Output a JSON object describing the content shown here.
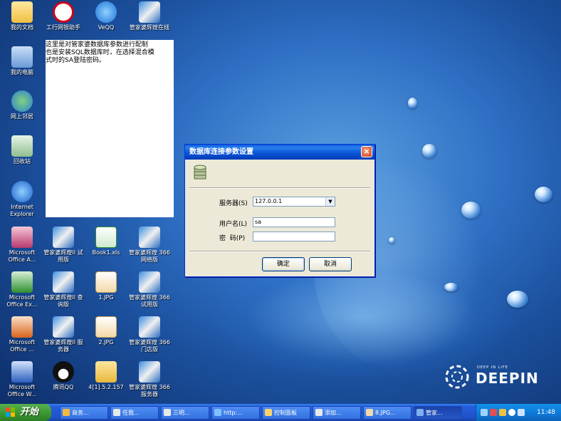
{
  "desktop": {
    "icons": [
      {
        "label": "我的文档",
        "icon": "my-documents-icon"
      },
      {
        "label": "工行网银助手",
        "icon": "icbc-bank-icon"
      },
      {
        "label": "VeQQ",
        "icon": "qq-ie-icon"
      },
      {
        "label": "管家婆辉煌在线",
        "icon": "gjp-app-icon"
      },
      {
        "label": "我的电脑",
        "icon": "my-computer-icon"
      },
      {
        "label": "网上邻居",
        "icon": "network-places-icon"
      },
      {
        "label": "回收站",
        "icon": "recycle-bin-icon"
      },
      {
        "label": "Internet Explorer",
        "icon": "internet-explorer-icon"
      },
      {
        "label": "Microsoft Office A...",
        "icon": "office-access-icon"
      },
      {
        "label": "管家婆辉煌II 试用版",
        "icon": "gjp-app-icon"
      },
      {
        "label": "Book1.xls",
        "icon": "excel-file-icon"
      },
      {
        "label": "管家婆辉煌 366网络版",
        "icon": "gjp-app-icon"
      },
      {
        "label": "Microsoft Office Ex...",
        "icon": "office-excel-icon"
      },
      {
        "label": "管家婆辉煌II 查询版",
        "icon": "gjp-app-icon"
      },
      {
        "label": "1.JPG",
        "icon": "jpg-file-icon"
      },
      {
        "label": "管家婆辉煌 366试用版",
        "icon": "gjp-app-icon"
      },
      {
        "label": "Microsoft Office ...",
        "icon": "office-powerpoint-icon"
      },
      {
        "label": "管家婆辉煌II 服务器",
        "icon": "gjp-app-icon"
      },
      {
        "label": "2.JPG",
        "icon": "jpg-file-icon"
      },
      {
        "label": "管家婆辉煌 366门店版",
        "icon": "gjp-app-icon"
      },
      {
        "label": "Microsoft Office W...",
        "icon": "office-word-icon"
      },
      {
        "label": "腾讯QQ",
        "icon": "qq-penguin-icon"
      },
      {
        "label": "4[1].5.2.157",
        "icon": "folder-icon"
      },
      {
        "label": "管家婆辉煌 366服务器",
        "icon": "gjp-app-icon"
      }
    ],
    "note": {
      "lines": [
        "这里是对管家婆数据库参数进行配制",
        "也是安装SQL数据库时，在选择混合模",
        "式时的SA登陆密码。"
      ]
    },
    "brand": {
      "tagline": "DEEP IN LIFE",
      "name": "DEEPIN"
    }
  },
  "dialog": {
    "title": "数据库连接参数设置",
    "close_label": "×",
    "server_label": "服务器(S)",
    "server_value": "127.0.0.1",
    "username_label": "用户名(L)",
    "username_value": "sa",
    "password_label": "密  码(P)",
    "password_value": "",
    "ok_label": "确定",
    "cancel_label": "取消"
  },
  "taskbar": {
    "start_label": "开始",
    "buttons": [
      {
        "label": "商务..."
      },
      {
        "label": "任我..."
      },
      {
        "label": "三明..."
      },
      {
        "label": "http:..."
      },
      {
        "label": "控制面板"
      },
      {
        "label": "添加..."
      },
      {
        "label": "8.JPG..."
      },
      {
        "label": "管家..."
      }
    ],
    "clock": "11:48"
  },
  "colors": {
    "desktop_bg": "#1b4f9c",
    "taskbar": "#245edb",
    "start_green": "#3c9a32",
    "dialog_title": "#0a56d6",
    "dialog_body": "#ece9d8"
  }
}
